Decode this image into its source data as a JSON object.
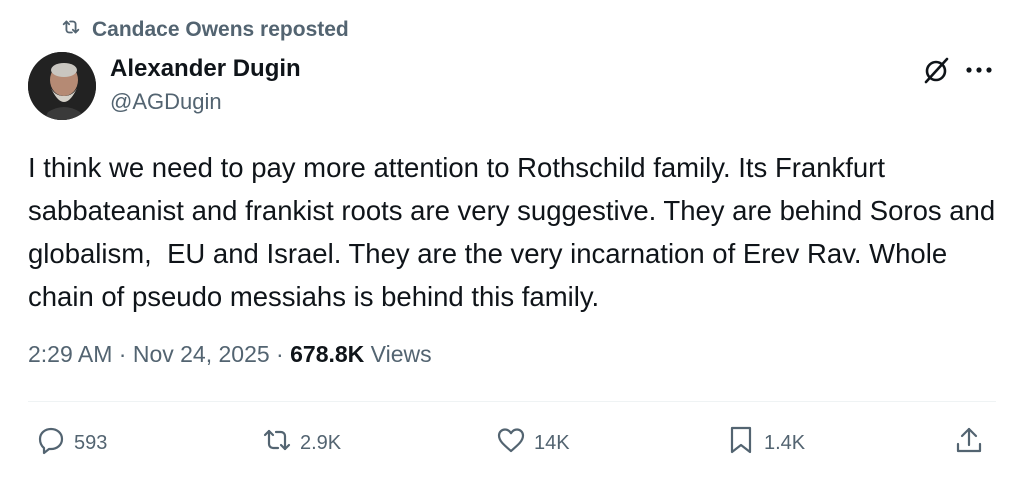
{
  "repost": {
    "text": "Candace Owens reposted",
    "icon": "repost-icon"
  },
  "author": {
    "name": "Alexander Dugin",
    "handle": "@AGDugin",
    "avatar": "avatar"
  },
  "tweet": {
    "text": "I think we need to pay more attention to Rothschild family. Its Frankfurt sabbateanist and frankist roots are very suggestive. They are behind Soros and globalism,  EU and Israel. They are the very incarnation of Erev Rav. Whole chain of pseudo messiahs is behind this family."
  },
  "meta": {
    "time": "2:29 AM",
    "separator": " · ",
    "date": "Nov 24, 2025",
    "views_count": "678.8K",
    "views_label": " Views"
  },
  "actions": {
    "replies": "593",
    "reposts": "2.9K",
    "likes": "14K",
    "bookmarks": "1.4K"
  },
  "colors": {
    "text": "#0f1419",
    "secondary": "#536471",
    "divider": "#eff3f4"
  }
}
